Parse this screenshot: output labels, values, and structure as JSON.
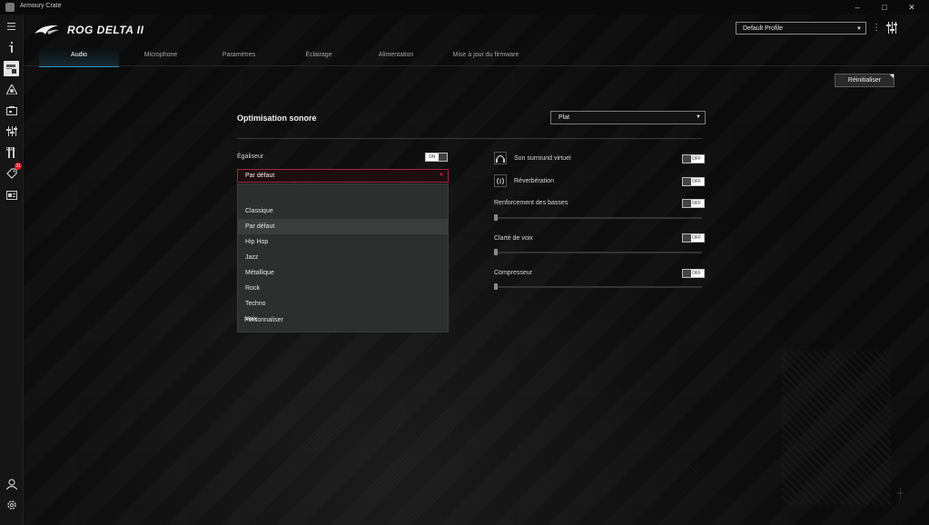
{
  "window": {
    "title": "Armoury Crate",
    "minimize": "–",
    "maximize": "□",
    "close": "✕"
  },
  "sidebar": {
    "items": [
      {
        "icon": "menu-icon"
      },
      {
        "icon": "info-icon"
      },
      {
        "icon": "device-icon",
        "active": true
      },
      {
        "icon": "aura-icon"
      },
      {
        "icon": "gamevisual-icon"
      },
      {
        "icon": "sliders-icon"
      },
      {
        "icon": "tools-icon"
      },
      {
        "icon": "deals-icon",
        "badge": "31"
      },
      {
        "icon": "news-icon"
      }
    ],
    "bottom": [
      {
        "icon": "user-icon"
      },
      {
        "icon": "settings-icon"
      }
    ]
  },
  "header": {
    "device_name": "ROG DELTA II",
    "profile": "Default Profile"
  },
  "tabs": [
    {
      "label": "Audio",
      "active": true
    },
    {
      "label": "Microphone"
    },
    {
      "label": "Paramètres"
    },
    {
      "label": "Éclairage"
    },
    {
      "label": "Alimentation"
    },
    {
      "label": "Mise à jour du firmware"
    }
  ],
  "reset_label": "Réinitialiser",
  "sound": {
    "title": "Optimisation sonore",
    "preset": "Plat",
    "equalizer": {
      "label": "Égaliseur",
      "toggle": "ON",
      "selected": "Par défaut",
      "options": [
        "Classique",
        "Par défaut",
        "Hip Hop",
        "Jazz",
        "Métallique",
        "Rock",
        "Techno",
        "Voix",
        "Personnaliser"
      ]
    },
    "surround": {
      "label": "Son surround virtuel",
      "toggle": "OFF"
    },
    "reverb": {
      "label": "Réverbération",
      "toggle": "OFF"
    },
    "bass": {
      "label": "Renforcement des basses",
      "toggle": "OFF",
      "level": 0
    },
    "voice": {
      "label": "Clarté de voix",
      "toggle": "OFF",
      "level": 0
    },
    "compressor": {
      "label": "Compresseur",
      "toggle": "OFF",
      "level": 0
    }
  }
}
